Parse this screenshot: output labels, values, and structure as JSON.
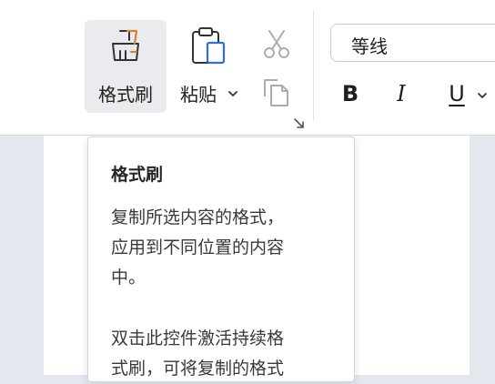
{
  "toolbar": {
    "format_painter_label": "格式刷",
    "paste_label": "粘贴",
    "font_name": "等线",
    "bold_label": "B",
    "italic_label": "I",
    "underline_label": "U"
  },
  "tooltip": {
    "title": "格式刷",
    "paragraph1": "复制所选内容的格式，\n应用到不同位置的内容\n中。",
    "paragraph2": "双击此控件激活持续格\n式刷，可将复制的格式"
  },
  "colors": {
    "ribbon_bg": "#ffffff",
    "selected_button_bg": "#e9ebee",
    "canvas_bg": "#e3e8ef",
    "text": "#1f1f1f"
  }
}
